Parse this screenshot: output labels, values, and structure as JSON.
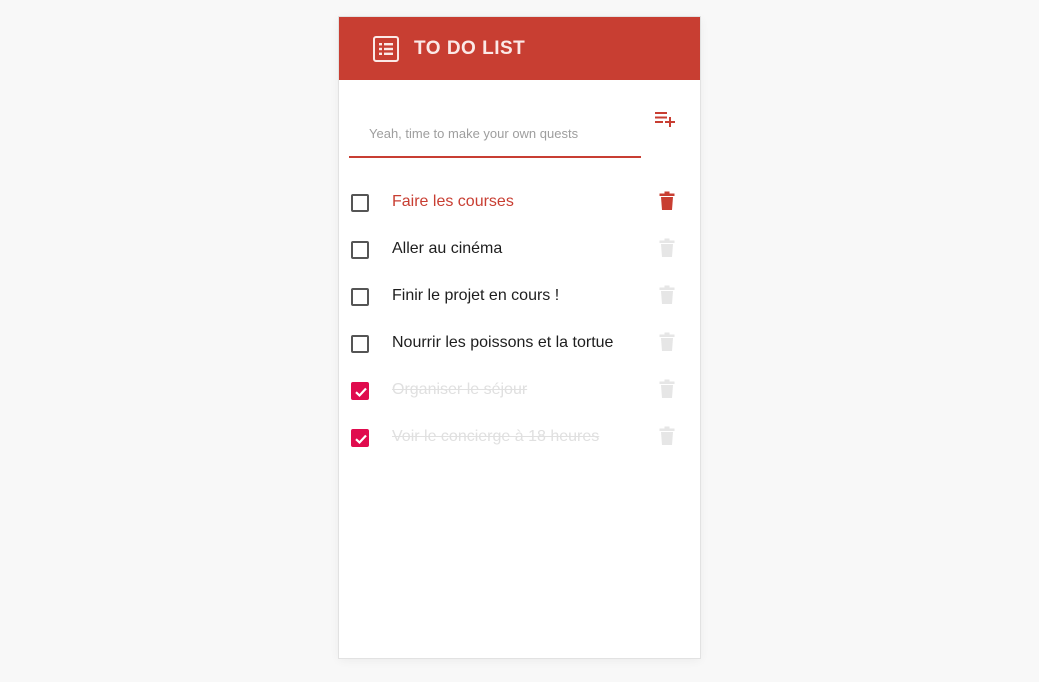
{
  "app": {
    "title": "TO DO LIST"
  },
  "colors": {
    "accent": "#c83e32",
    "checked": "#e00b4e",
    "trash_inactive": "#e6e6e6"
  },
  "input": {
    "placeholder": "Yeah, time to make your own quests",
    "value": ""
  },
  "add_button": {
    "icon": "playlist-add-icon"
  },
  "tasks": [
    {
      "label": "Faire les courses",
      "checked": false,
      "highlighted": true
    },
    {
      "label": "Aller au cinéma",
      "checked": false,
      "highlighted": false
    },
    {
      "label": "Finir le projet en cours !",
      "checked": false,
      "highlighted": false
    },
    {
      "label": "Nourrir les poissons et la tortue",
      "checked": false,
      "highlighted": false
    },
    {
      "label": "Organiser le séjour",
      "checked": true,
      "highlighted": false
    },
    {
      "label": "Voir le concierge à 18 heures",
      "checked": true,
      "highlighted": false
    }
  ]
}
